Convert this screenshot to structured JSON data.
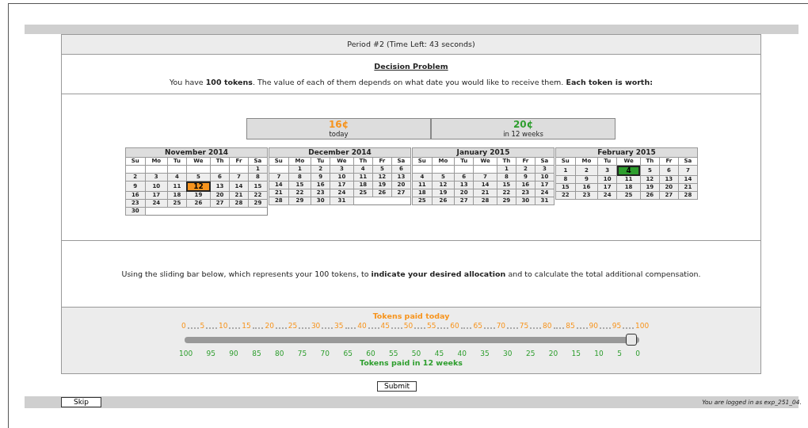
{
  "period_bar": {
    "text": "Period #2 (Time Left: 43 seconds)"
  },
  "intro": {
    "title": "Decision Problem",
    "text": "You have **100 tokens**. The value of each of them depends on what date you would like to receive them. **Each token is worth:**"
  },
  "values": [
    {
      "amount": "16¢",
      "when": "today",
      "color": "#f7941d"
    },
    {
      "amount": "20¢",
      "when": "in 12 weeks",
      "color": "#2e9e2e"
    }
  ],
  "calendars": [
    {
      "month": "November 2014",
      "weekdays": [
        "Su",
        "Mo",
        "Tu",
        "We",
        "Th",
        "Fr",
        "Sa"
      ],
      "weeks": [
        [
          {
            "kind": "blank"
          },
          {
            "kind": "blank"
          },
          {
            "kind": "blank"
          },
          {
            "kind": "blank"
          },
          {
            "kind": "blank"
          },
          {
            "kind": "blank"
          },
          "1"
        ],
        [
          "2",
          "3",
          "4",
          "5",
          "6",
          "7",
          "8"
        ],
        [
          "9",
          "10",
          "11",
          {
            "kind": "day",
            "day": "12",
            "highlighted": true,
            "color": "#f7941d"
          },
          "13",
          "14",
          "15"
        ],
        [
          "16",
          "17",
          "18",
          "19",
          "20",
          "21",
          "22"
        ],
        [
          "23",
          "24",
          "25",
          "26",
          "27",
          "28",
          "29"
        ],
        [
          "30"
        ]
      ]
    },
    {
      "month": "December 2014",
      "weekdays": [
        "Su",
        "Mo",
        "Tu",
        "We",
        "Th",
        "Fr",
        "Sa"
      ],
      "weeks": [
        [
          {
            "kind": "blank"
          },
          "1",
          "2",
          "3",
          "4",
          "5",
          "6"
        ],
        [
          "7",
          "8",
          "9",
          "10",
          "11",
          "12",
          "13"
        ],
        [
          "14",
          "15",
          "16",
          "17",
          "18",
          "19",
          "20"
        ],
        [
          "21",
          "22",
          "23",
          "24",
          "25",
          "26",
          "27"
        ],
        [
          "28",
          "29",
          "30",
          "31"
        ]
      ]
    },
    {
      "month": "January 2015",
      "weekdays": [
        "Su",
        "Mo",
        "Tu",
        "We",
        "Th",
        "Fr",
        "Sa"
      ],
      "weeks": [
        [
          {
            "kind": "blank"
          },
          {
            "kind": "blank"
          },
          {
            "kind": "blank"
          },
          {
            "kind": "blank"
          },
          "1",
          "2",
          "3"
        ],
        [
          "4",
          "5",
          "6",
          "7",
          "8",
          "9",
          "10"
        ],
        [
          "11",
          "12",
          "13",
          "14",
          "15",
          "16",
          "17"
        ],
        [
          "18",
          "19",
          "20",
          "21",
          "22",
          "23",
          "24"
        ],
        [
          "25",
          "26",
          "27",
          "28",
          "29",
          "30",
          "31"
        ]
      ]
    },
    {
      "month": "February 2015",
      "weekdays": [
        "Su",
        "Mo",
        "Tu",
        "We",
        "Th",
        "Fr",
        "Sa"
      ],
      "weeks": [
        [
          "1",
          "2",
          "3",
          {
            "kind": "day",
            "day": "4",
            "highlighted": true,
            "color": "#2e9e2e"
          },
          "5",
          "6",
          "7"
        ],
        [
          "8",
          "9",
          "10",
          "11",
          "12",
          "13",
          "14"
        ],
        [
          "15",
          "16",
          "17",
          "18",
          "19",
          "20",
          "21"
        ],
        [
          "22",
          "23",
          "24",
          "25",
          "26",
          "27",
          "28"
        ]
      ]
    }
  ],
  "instruction": "Using the sliding bar below, which represents your 100 tokens, to **indicate your desired allocation** and to calculate the total additional compensation.",
  "slider": {
    "top_title": "Tokens paid today",
    "top_ticks": [
      "0",
      "5",
      "10",
      "15",
      "20",
      "25",
      "30",
      "35",
      "40",
      "45",
      "50",
      "55",
      "60",
      "65",
      "70",
      "75",
      "80",
      "85",
      "90",
      "95",
      "100"
    ],
    "level": 0.98,
    "bottom_ticks": [
      "100",
      "95",
      "90",
      "85",
      "80",
      "75",
      "70",
      "65",
      "60",
      "55",
      "50",
      "45",
      "40",
      "35",
      "30",
      "25",
      "20",
      "15",
      "10",
      "5",
      "0"
    ],
    "bottom_title": "Tokens paid in 12 weeks"
  },
  "submit_button": "Submit",
  "footer": {
    "skip_button": "Skip",
    "login_text": "You are logged in as exp_251_04."
  }
}
